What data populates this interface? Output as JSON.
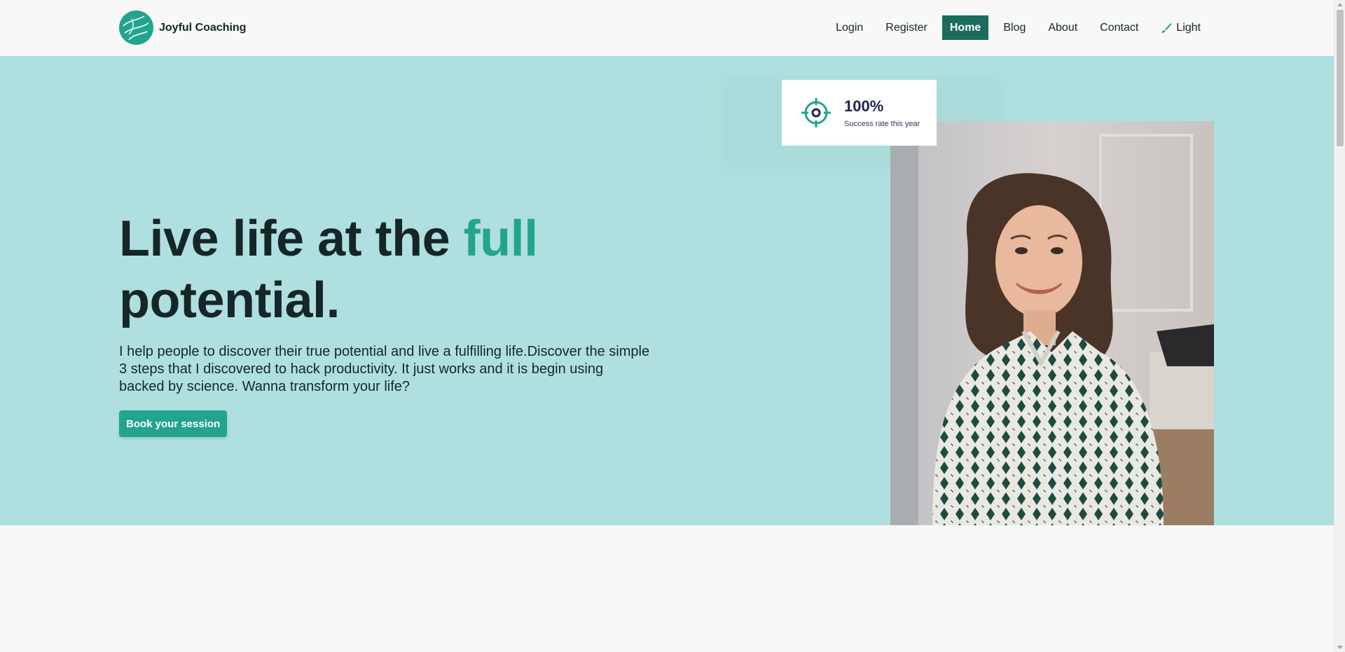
{
  "brand": {
    "name": "Joyful Coaching"
  },
  "nav": {
    "items": [
      {
        "label": "Login"
      },
      {
        "label": "Register"
      },
      {
        "label": "Home"
      },
      {
        "label": "Blog"
      },
      {
        "label": "About"
      },
      {
        "label": "Contact"
      }
    ],
    "theme_toggle": {
      "label": "Light",
      "icon": "brush-icon"
    }
  },
  "hero": {
    "title_prefix": "Live life at the ",
    "title_accent": "full",
    "title_suffix": "potential.",
    "text": "I help people to discover their true potential and live a fulfilling life.Discover the simple 3 steps that I discovered to hack productivity. It just works and it is begin using backed by science. Wanna transform your life?",
    "cta_label": "Book your session"
  },
  "stat": {
    "value": "100%",
    "label": "Success rate this year",
    "icon": "target-icon"
  },
  "colors": {
    "accent": "#23a48f",
    "nav_active": "#1d6b5c",
    "hero_bg": "#afe0df",
    "text": "#162626"
  }
}
